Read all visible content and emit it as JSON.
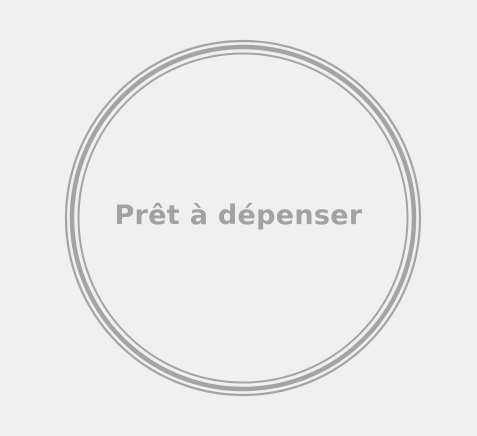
{
  "budget_ring": {
    "status_text": "Prêt à dépenser",
    "ring_color": "#a4a4a4",
    "text_color": "#a2a2a2",
    "background_color": "#f0f0f0"
  }
}
